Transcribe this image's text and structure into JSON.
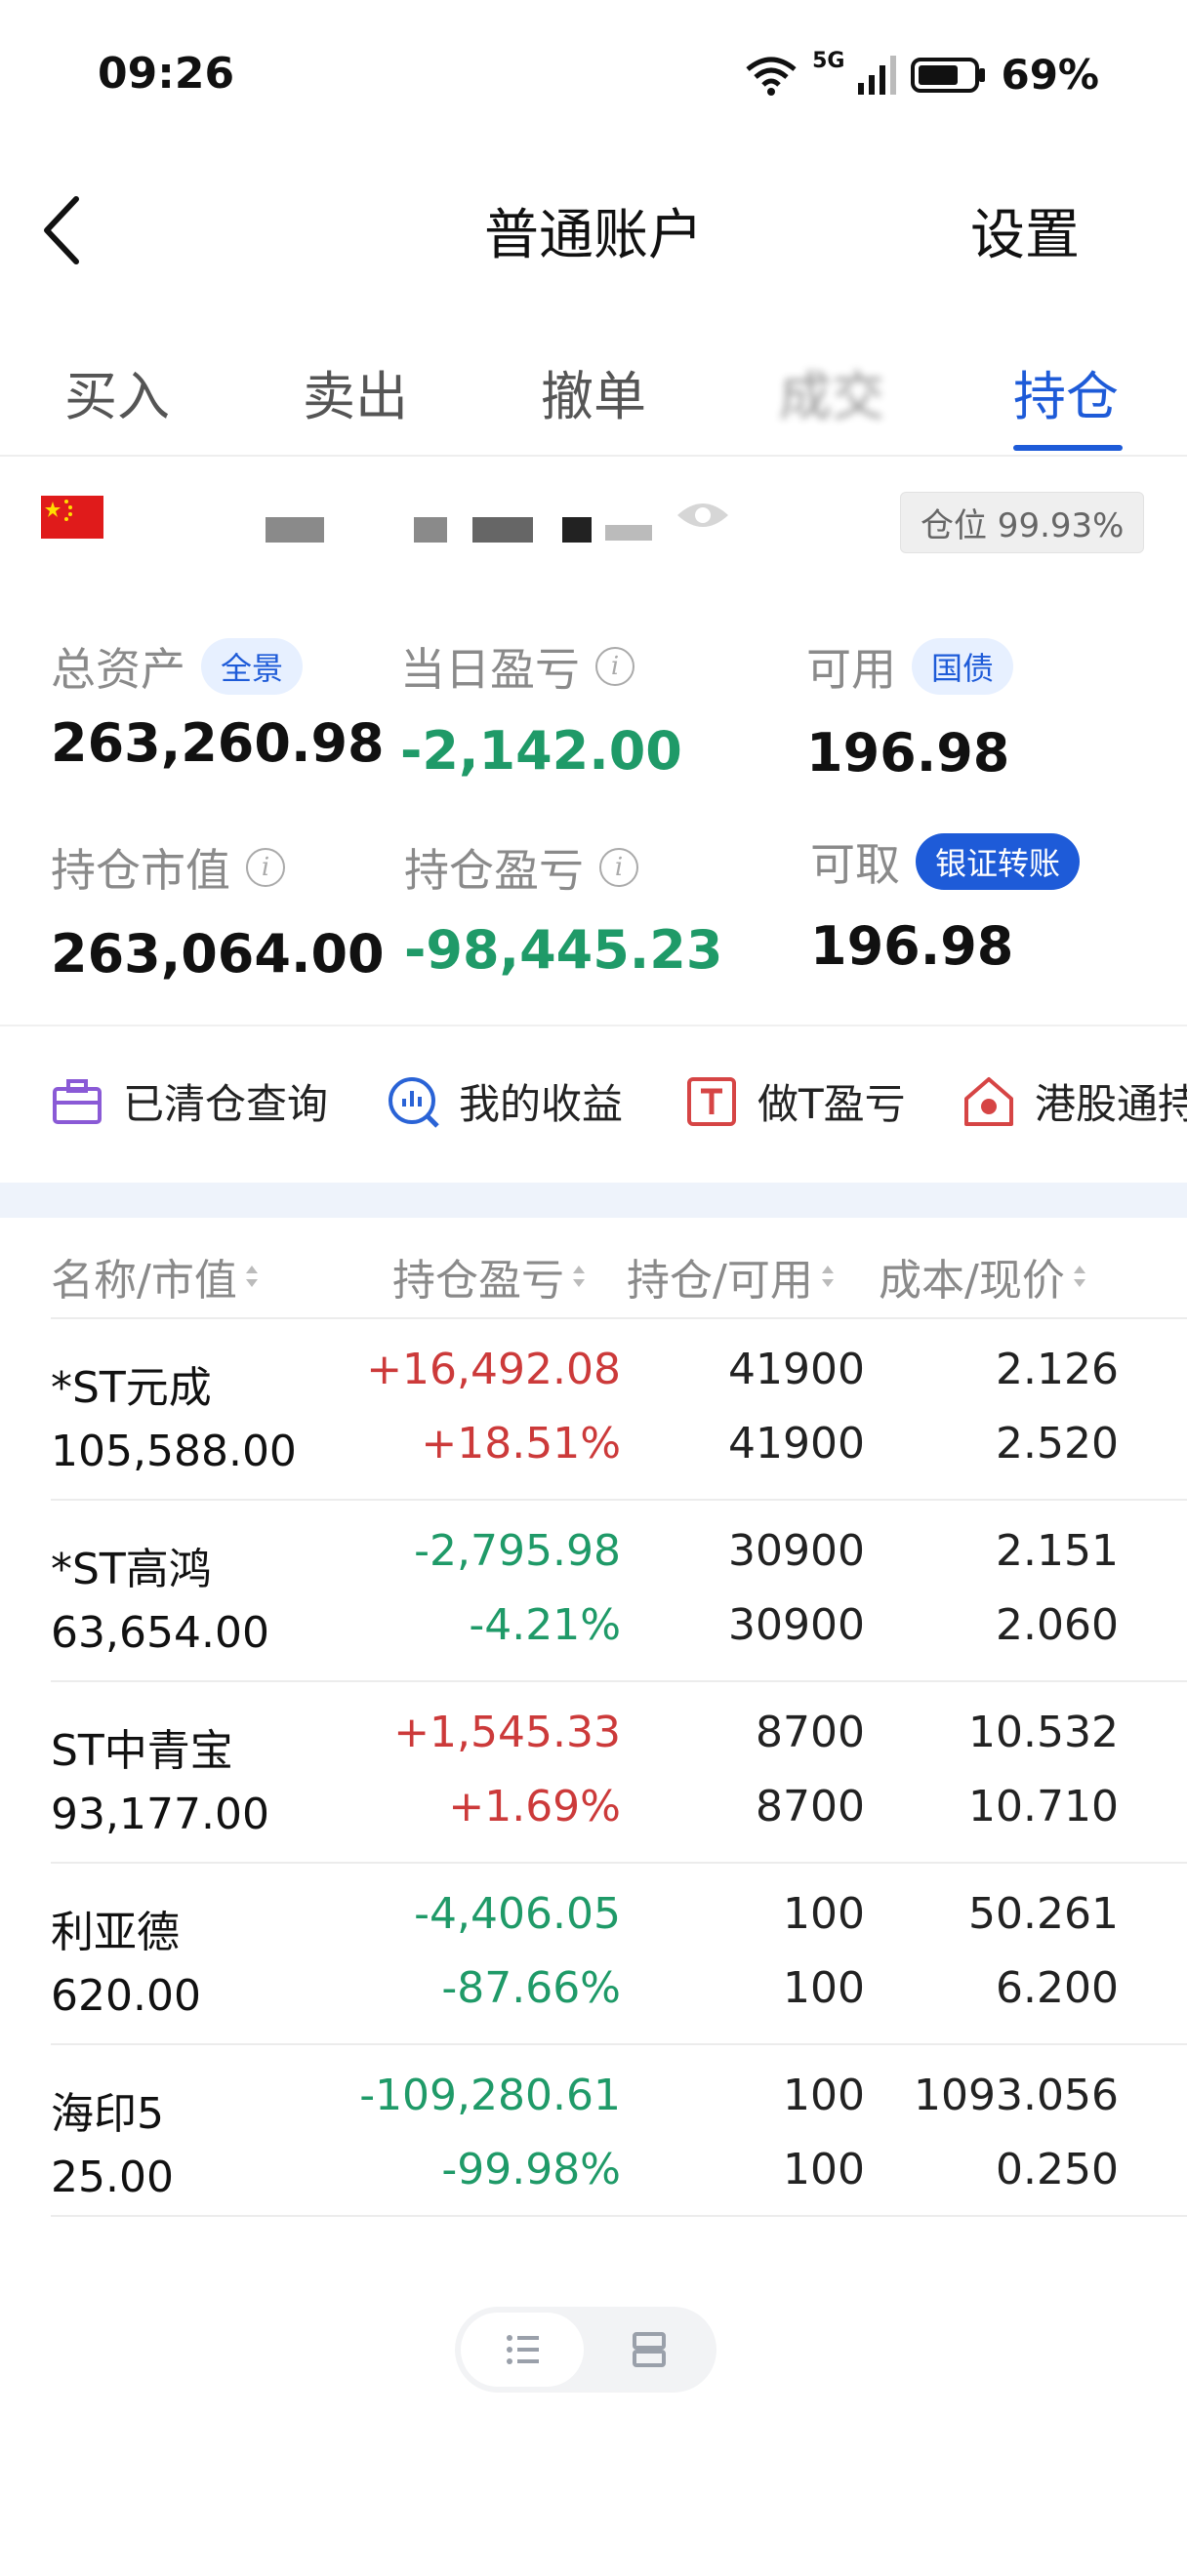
{
  "status_bar": {
    "time": "09:26",
    "network": "5G",
    "battery": "69%"
  },
  "header": {
    "title": "普通账户",
    "settings_label": "设置"
  },
  "tabs": [
    {
      "label": "买入"
    },
    {
      "label": "卖出"
    },
    {
      "label": "撤单"
    },
    {
      "label": "成交"
    },
    {
      "label": "持仓"
    }
  ],
  "account": {
    "position_ratio": "仓位 99.93%"
  },
  "assets": {
    "total_label": "总资产",
    "total_badge": "全景",
    "total_value": "263,260.98",
    "daily_pnl_label": "当日盈亏",
    "daily_pnl_value": "-2,142.00",
    "available_label": "可用",
    "available_badge": "国债",
    "available_value": "196.98",
    "market_value_label": "持仓市值",
    "market_value_value": "263,064.00",
    "holding_pnl_label": "持仓盈亏",
    "holding_pnl_value": "-98,445.23",
    "withdrawable_label": "可取",
    "withdrawable_badge": "银证转账",
    "withdrawable_value": "196.98"
  },
  "shortcuts": [
    {
      "label": "已清仓查询",
      "icon": "briefcase-icon"
    },
    {
      "label": "我的收益",
      "icon": "chart-search-icon"
    },
    {
      "label": "做T盈亏",
      "icon": "t-box-icon"
    },
    {
      "label": "港股通持",
      "icon": "hk-home-icon"
    }
  ],
  "table": {
    "columns": [
      "名称/市值",
      "持仓盈亏",
      "持仓/可用",
      "成本/现价"
    ],
    "rows": [
      {
        "name": "*ST元成",
        "market_value": "105,588.00",
        "pnl": "+16,492.08",
        "pnl_pct": "+18.51%",
        "qty": "41900",
        "avail": "41900",
        "cost": "2.126",
        "price": "2.520",
        "dir": "up"
      },
      {
        "name": "*ST高鸿",
        "market_value": "63,654.00",
        "pnl": "-2,795.98",
        "pnl_pct": "-4.21%",
        "qty": "30900",
        "avail": "30900",
        "cost": "2.151",
        "price": "2.060",
        "dir": "down"
      },
      {
        "name": "ST中青宝",
        "market_value": "93,177.00",
        "pnl": "+1,545.33",
        "pnl_pct": "+1.69%",
        "qty": "8700",
        "avail": "8700",
        "cost": "10.532",
        "price": "10.710",
        "dir": "up"
      },
      {
        "name": "利亚德",
        "market_value": "620.00",
        "pnl": "-4,406.05",
        "pnl_pct": "-87.66%",
        "qty": "100",
        "avail": "100",
        "cost": "50.261",
        "price": "6.200",
        "dir": "down"
      },
      {
        "name": "海印5",
        "market_value": "25.00",
        "pnl": "-109,280.61",
        "pnl_pct": "-99.98%",
        "qty": "100",
        "avail": "100",
        "cost": "1093.056",
        "price": "0.250",
        "dir": "down"
      }
    ]
  },
  "colors": {
    "accent": "#1e5bd8",
    "up": "#cc3a3a",
    "down": "#1f9a68"
  }
}
